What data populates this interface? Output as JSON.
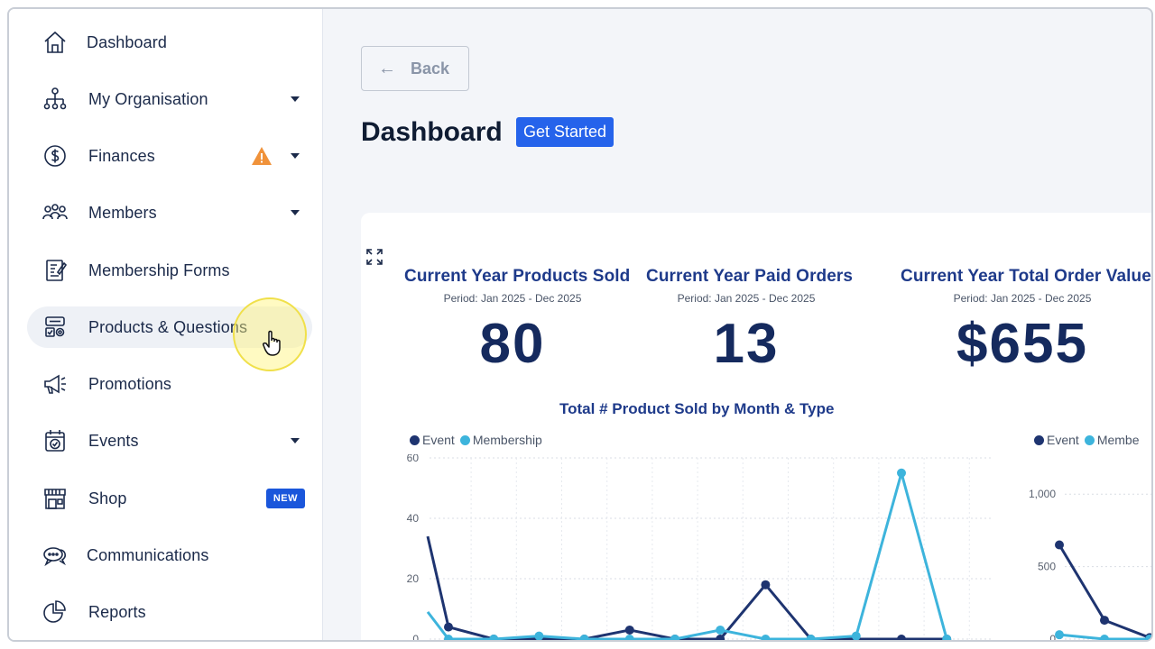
{
  "sidebar": {
    "items": [
      {
        "label": "Dashboard",
        "icon": "home-icon"
      },
      {
        "label": "My Organisation",
        "icon": "org-chart-icon"
      },
      {
        "label": "Finances",
        "icon": "dollar-icon"
      },
      {
        "label": "Members",
        "icon": "people-icon"
      },
      {
        "label": "Membership Forms",
        "icon": "form-icon"
      },
      {
        "label": "Products & Questions",
        "icon": "products-icon"
      },
      {
        "label": "Promotions",
        "icon": "megaphone-icon"
      },
      {
        "label": "Events",
        "icon": "calendar-icon"
      },
      {
        "label": "Shop",
        "icon": "store-icon"
      },
      {
        "label": "Communications",
        "icon": "chat-icon"
      },
      {
        "label": "Reports",
        "icon": "pie-chart-icon"
      }
    ],
    "shop_badge": "NEW",
    "warning_color": "#f0923a"
  },
  "main": {
    "back_label": "Back",
    "back_arrow": "←",
    "page_title": "Dashboard",
    "get_started_label": "Get Started"
  },
  "kpis": [
    {
      "title": "Current Year Products Sold",
      "period": "Period: Jan 2025 - Dec 2025",
      "value": "80"
    },
    {
      "title": "Current Year Paid Orders",
      "period": "Period: Jan 2025 - Dec 2025",
      "value": "13"
    },
    {
      "title": "Current Year Total Order Value",
      "period": "Period: Jan 2025 - Dec 2025",
      "value": "$655"
    }
  ],
  "colors": {
    "event": "#1e3470",
    "membership": "#3db4dc",
    "accent": "#2563eb"
  },
  "chart_data": [
    {
      "type": "line",
      "title": "Total # Product Sold by Month & Type",
      "legend": [
        "Event",
        "Membership"
      ],
      "legend_position": "top-left",
      "ylim": [
        0,
        60
      ],
      "yticks": [
        0,
        20,
        40,
        60
      ],
      "grid": true,
      "x": [
        1,
        2,
        3,
        4,
        5,
        6,
        7,
        8,
        9,
        10,
        11,
        12
      ],
      "series": [
        {
          "name": "Event",
          "values": [
            4,
            0,
            0,
            0,
            3,
            0,
            0,
            18,
            0,
            0,
            0,
            0
          ]
        },
        {
          "name": "Membership",
          "values": [
            0,
            0,
            1,
            0,
            0,
            0,
            3,
            0,
            0,
            1,
            55,
            0
          ]
        }
      ]
    },
    {
      "type": "line",
      "title": "",
      "legend": [
        "Event",
        "Membe"
      ],
      "legend_position": "top-left",
      "ylim": [
        0,
        1250
      ],
      "yticks": [
        0,
        500,
        1000
      ],
      "ytick_labels": [
        "0",
        "500",
        "1,000"
      ],
      "grid": true,
      "x": [
        1,
        2,
        3
      ],
      "series": [
        {
          "name": "Event",
          "values": [
            650,
            130,
            10
          ]
        },
        {
          "name": "Membe",
          "values": [
            30,
            0,
            0
          ]
        }
      ]
    }
  ]
}
